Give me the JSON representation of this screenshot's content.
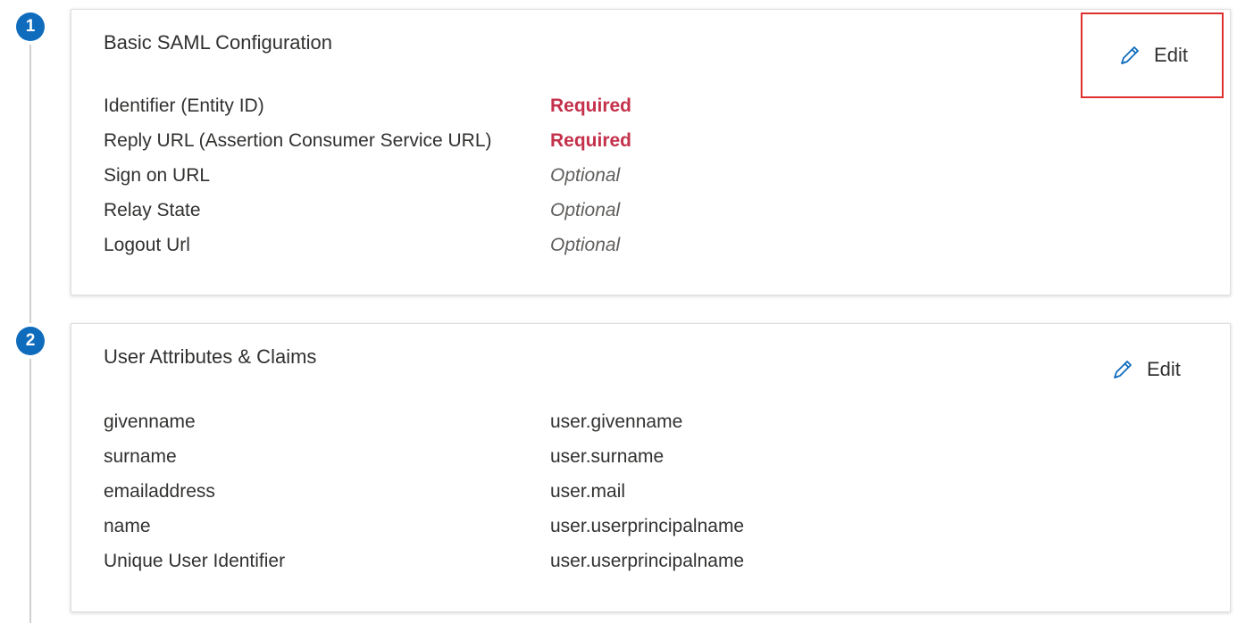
{
  "steps": [
    {
      "number": "1",
      "title": "Basic SAML Configuration",
      "edit_label": "Edit",
      "rows": [
        {
          "label": "Identifier (Entity ID)",
          "value": "Required",
          "status": "required"
        },
        {
          "label": "Reply URL (Assertion Consumer Service URL)",
          "value": "Required",
          "status": "required"
        },
        {
          "label": "Sign on URL",
          "value": "Optional",
          "status": "optional"
        },
        {
          "label": "Relay State",
          "value": "Optional",
          "status": "optional"
        },
        {
          "label": "Logout Url",
          "value": "Optional",
          "status": "optional"
        }
      ]
    },
    {
      "number": "2",
      "title": "User Attributes & Claims",
      "edit_label": "Edit",
      "rows": [
        {
          "label": "givenname",
          "value": "user.givenname"
        },
        {
          "label": "surname",
          "value": "user.surname"
        },
        {
          "label": "emailaddress",
          "value": "user.mail"
        },
        {
          "label": "name",
          "value": "user.userprincipalname"
        },
        {
          "label": "Unique User Identifier",
          "value": "user.userprincipalname"
        }
      ]
    }
  ],
  "colors": {
    "badge": "#0f6cbd",
    "required": "#c4314b",
    "highlight_box": "#e0302e",
    "pencil_icon": "#0f6cbd"
  },
  "icons": {
    "edit": "pencil-icon"
  }
}
